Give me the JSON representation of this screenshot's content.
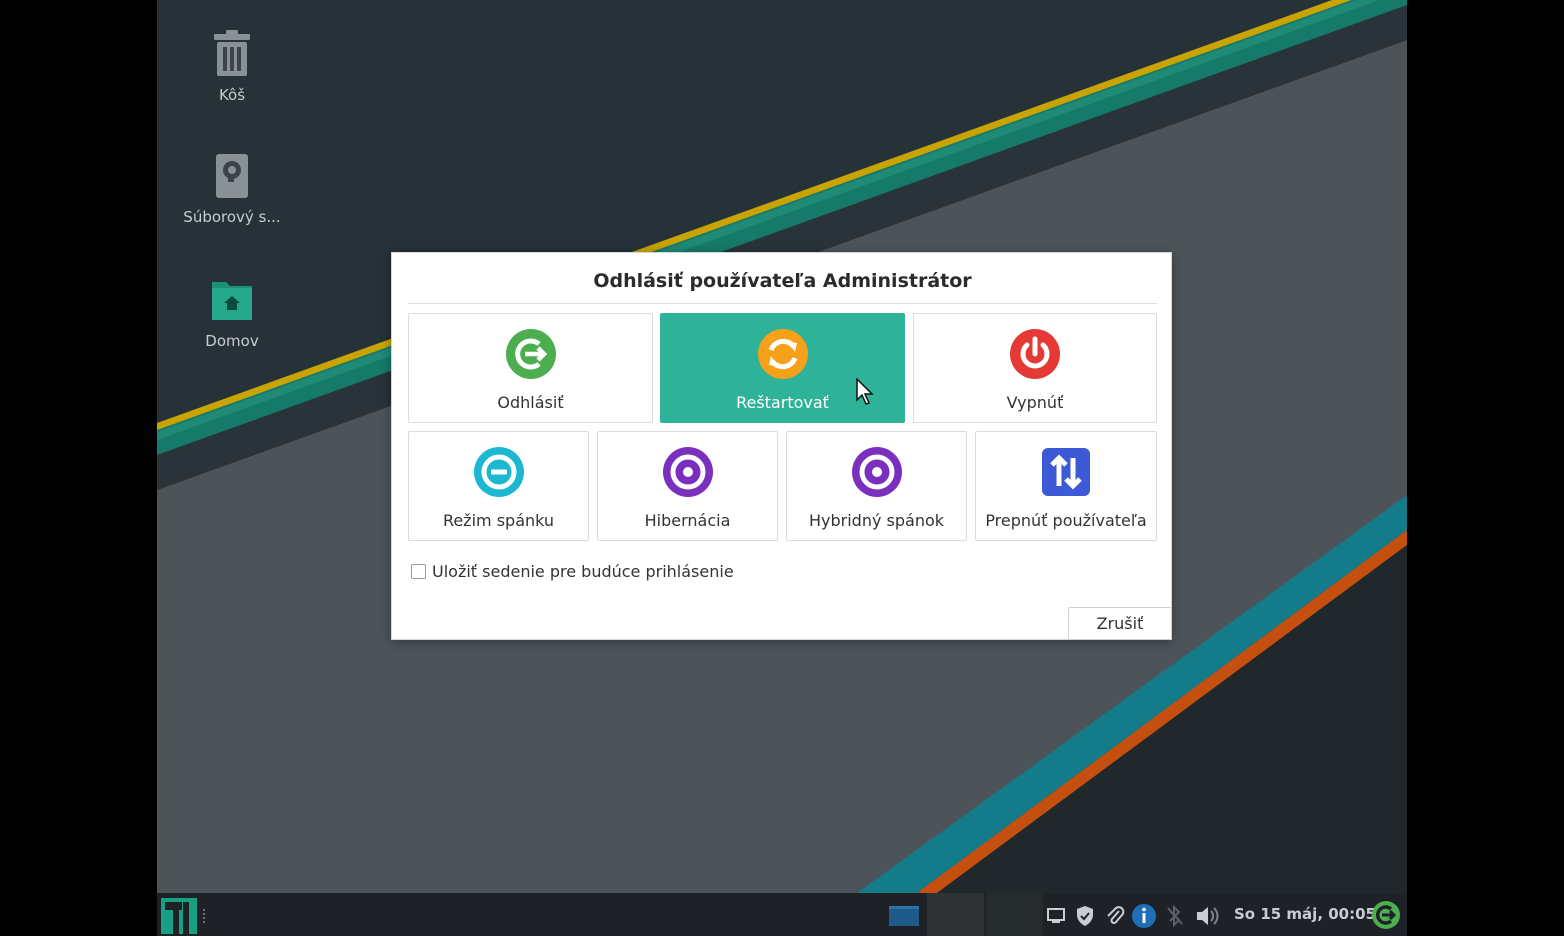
{
  "desktop": {
    "icons": [
      {
        "label": "Kôš",
        "icon": "trash-icon"
      },
      {
        "label": "Súborový s...",
        "icon": "drive-icon"
      },
      {
        "label": "Domov",
        "icon": "home-folder-icon"
      }
    ]
  },
  "dialog": {
    "title": "Odhlásiť používateľa Administrátor",
    "actions": [
      {
        "label": "Odhlásiť",
        "icon": "logout-icon",
        "color": "#4cae4f"
      },
      {
        "label": "Reštartovať",
        "icon": "restart-icon",
        "color": "#f7a11a",
        "selected": true
      },
      {
        "label": "Vypnúť",
        "icon": "power-icon",
        "color": "#e53935"
      },
      {
        "label": "Režim spánku",
        "icon": "suspend-icon",
        "color": "#1cb8d1"
      },
      {
        "label": "Hibernácia",
        "icon": "hibernate-icon",
        "color": "#7b2fbe"
      },
      {
        "label": "Hybridný spánok",
        "icon": "hybrid-sleep-icon",
        "color": "#7b2fbe"
      },
      {
        "label": "Prepnúť používateľa",
        "icon": "switch-user-icon",
        "color": "#3d5ad6"
      }
    ],
    "save_session_label": "Uložiť sedenie pre budúce prihlásenie",
    "save_session_checked": false,
    "cancel_label": "Zrušiť"
  },
  "panel": {
    "clock": "So 15 máj, 00:05",
    "tray_icons": [
      "display-icon",
      "shield-icon",
      "paperclip-icon",
      "info-icon",
      "bluetooth-disabled-icon",
      "volume-icon",
      "logout-icon"
    ]
  },
  "colors": {
    "accent": "#2eb398",
    "panel": "#1e2226"
  }
}
